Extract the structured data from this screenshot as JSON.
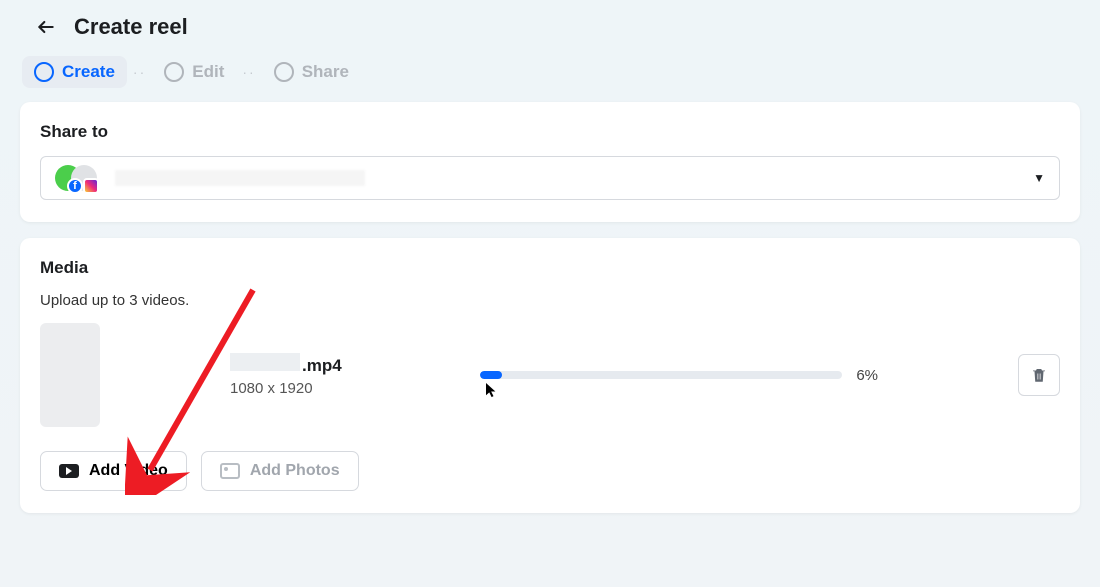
{
  "header": {
    "title": "Create reel"
  },
  "steps": [
    {
      "label": "Create",
      "active": true
    },
    {
      "label": "Edit",
      "active": false
    },
    {
      "label": "Share",
      "active": false
    }
  ],
  "share": {
    "title": "Share to"
  },
  "media": {
    "title": "Media",
    "subtitle": "Upload up to 3 videos.",
    "file": {
      "extension": ".mp4",
      "dimensions": "1080 x 1920",
      "progress_pct": 6,
      "progress_label": "6%"
    },
    "buttons": {
      "add_video": "Add Video",
      "add_photos": "Add Photos"
    }
  }
}
